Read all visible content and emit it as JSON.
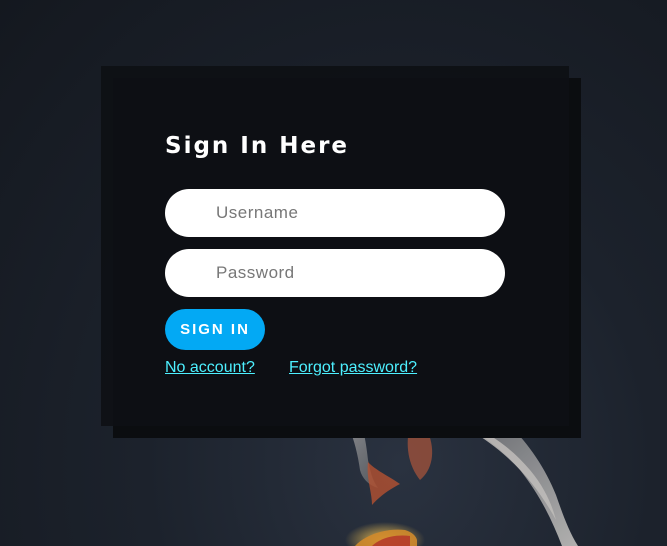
{
  "login": {
    "title": "Sign In Here",
    "username_placeholder": "Username",
    "password_placeholder": "Password",
    "signin_label": "SIGN IN",
    "no_account_link": "No account?",
    "forgot_password_link": "Forgot password?"
  },
  "colors": {
    "accent_button": "#03a9f4",
    "link": "#4df0ff",
    "card": "#0e1014",
    "background": "#1c222c"
  },
  "background_image": {
    "icon": "koi-fish-illustration"
  }
}
